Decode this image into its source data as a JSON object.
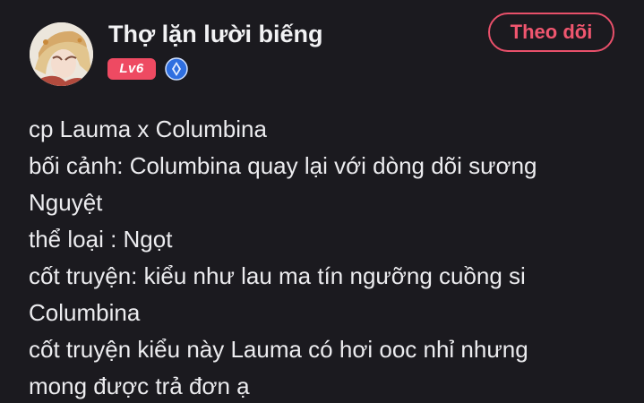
{
  "header": {
    "username": "Thợ lặn lười biếng",
    "level_badge": "Lv6",
    "follow_label": "Theo dõi",
    "avatar_icon": "avatar-anime-character",
    "verified_icon": "verified-blue-icon"
  },
  "post": {
    "lines": [
      "cp Lauma x Columbina",
      "bối cảnh: Columbina quay lại với dòng dõi sương",
      "Nguyệt",
      "thể loại : Ngọt",
      "cốt truyện: kiểu như lau ma tín ngưỡng cuồng si",
      "Columbina",
      "cốt truyện kiểu này Lauma có hơi ooc nhỉ nhưng",
      "mong được trả đơn ạ"
    ]
  },
  "colors": {
    "background": "#1b1a1f",
    "accent": "#ee4a62",
    "text": "#ececef",
    "verified": "#3b82f6"
  }
}
